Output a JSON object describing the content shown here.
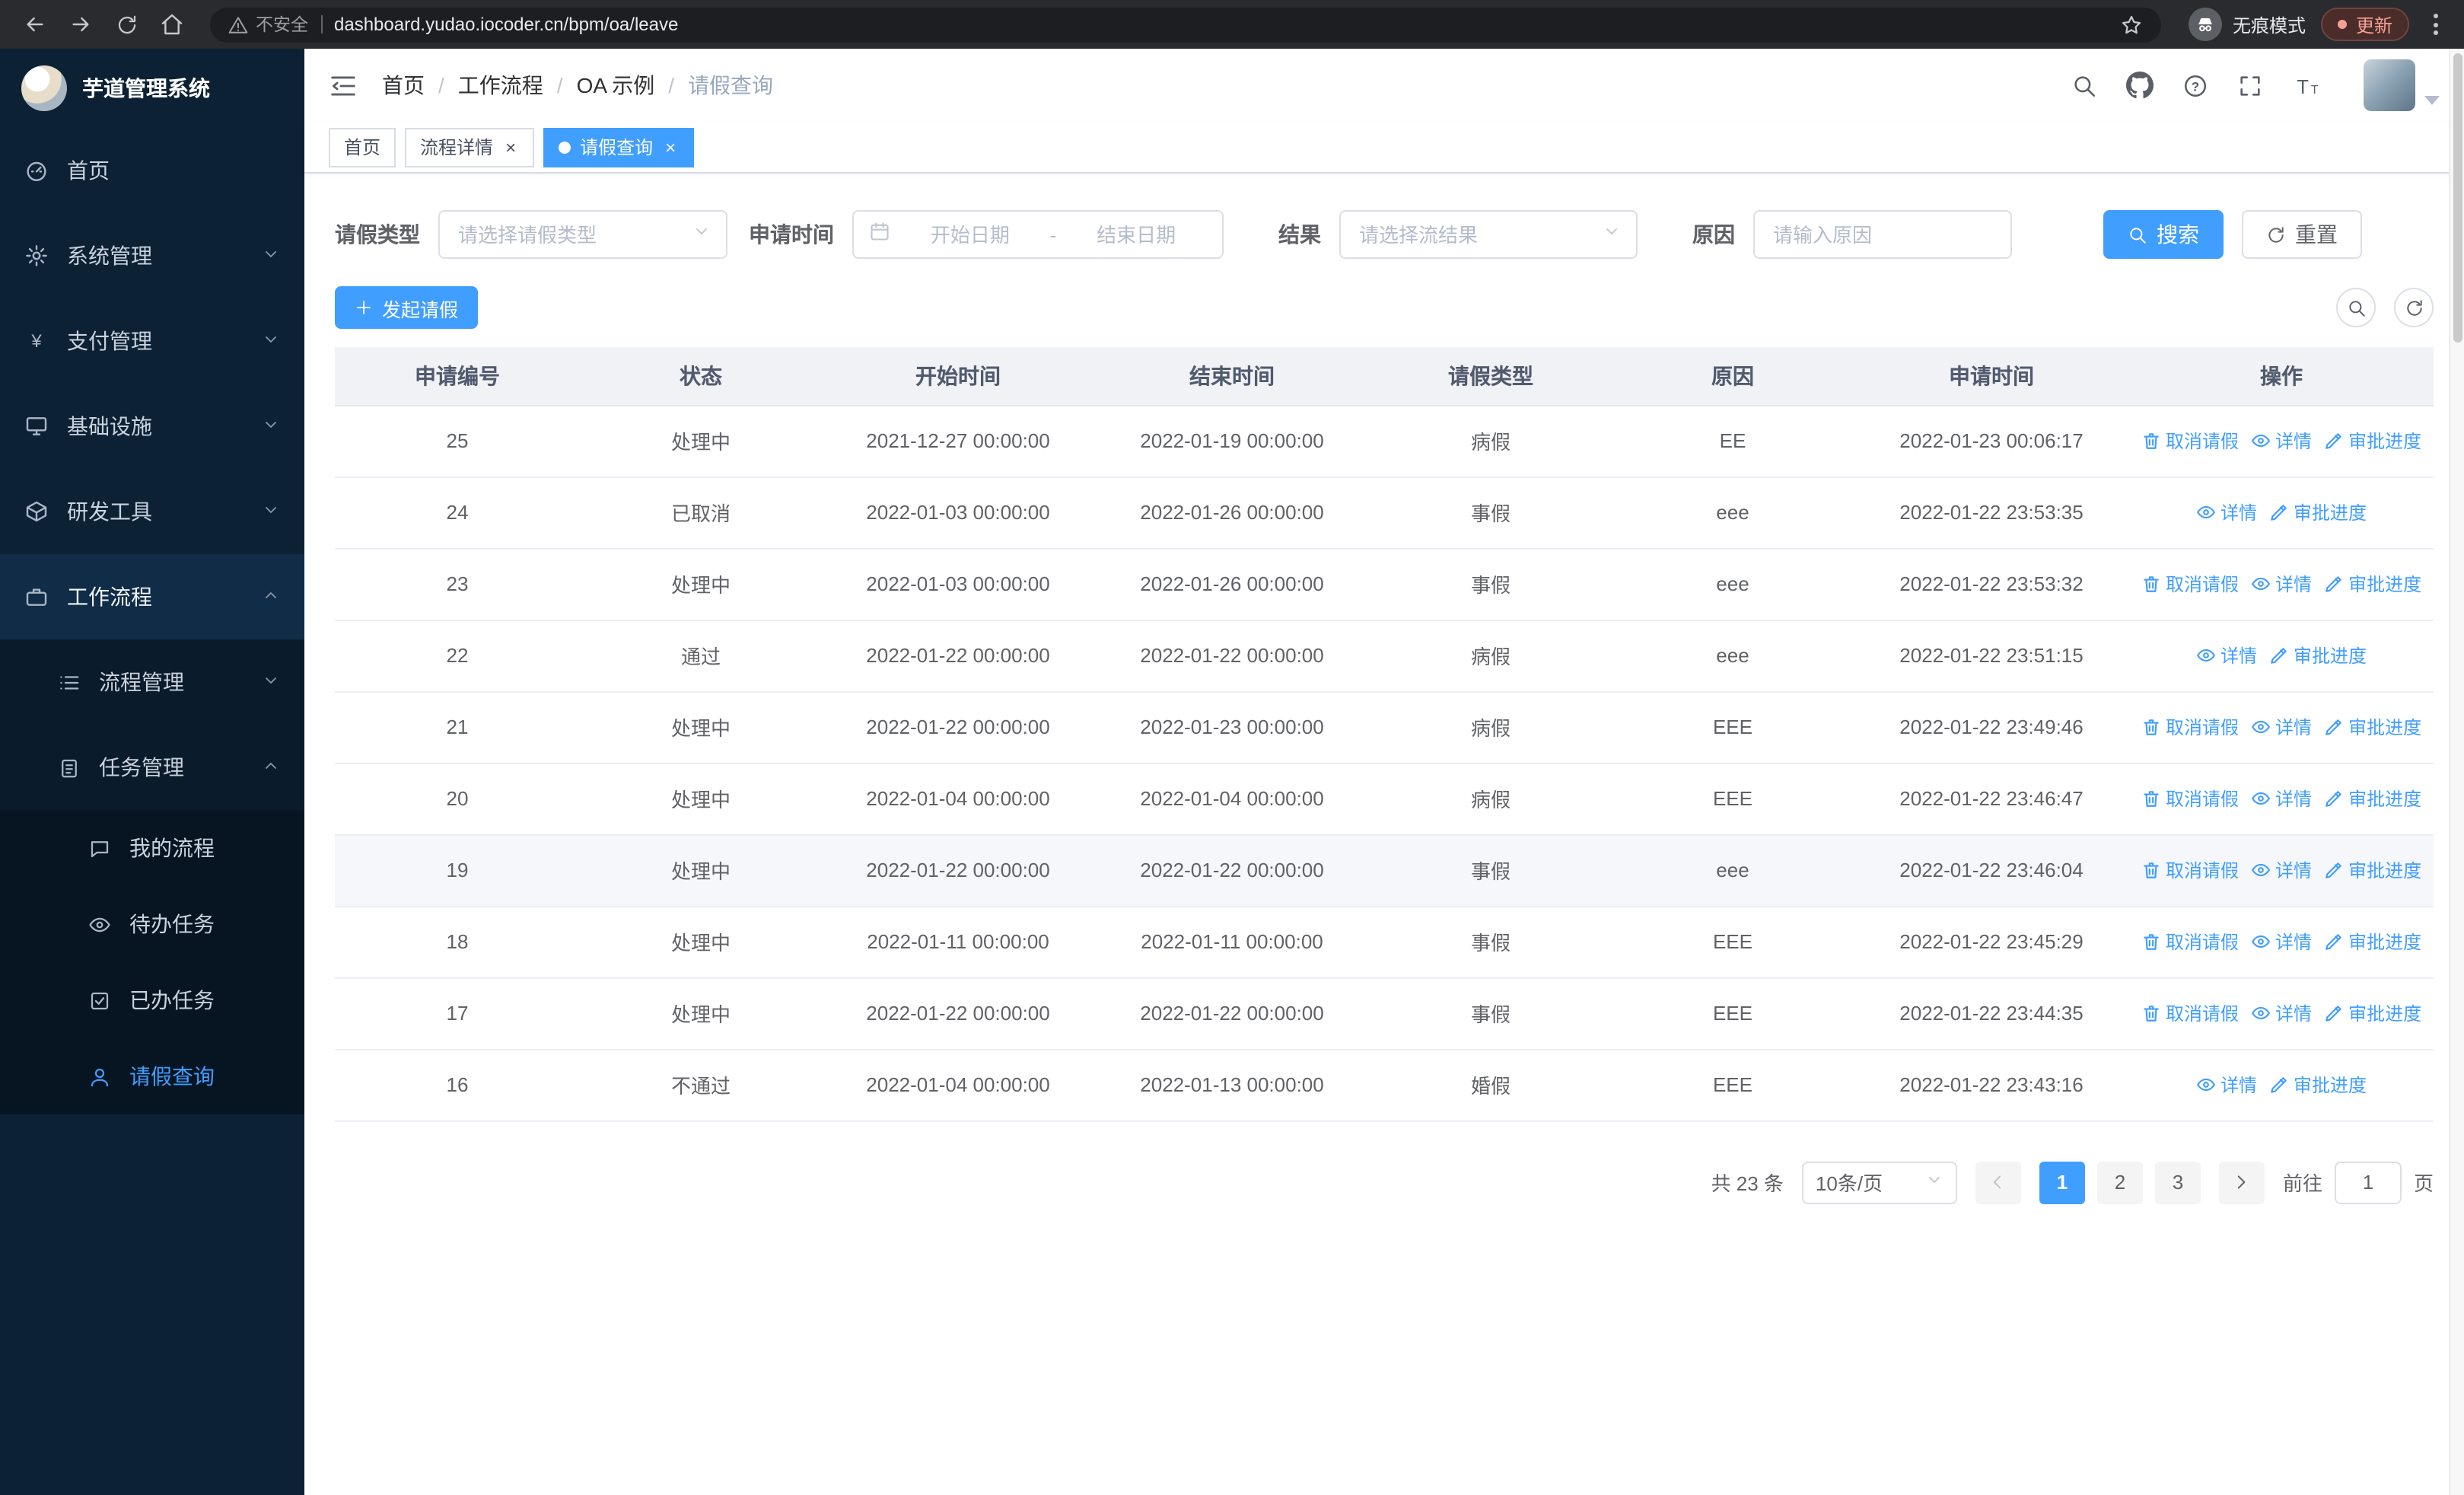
{
  "glyphs": {
    "close": "×"
  },
  "colors": {
    "accent": "#409eff"
  },
  "browser": {
    "security_label": "不安全",
    "url": "dashboard.yudao.iocoder.cn/bpm/oa/leave",
    "incognito_label": "无痕模式",
    "update_label": "更新"
  },
  "sidebar": {
    "app_title": "芋道管理系统",
    "items": [
      {
        "label": "首页"
      },
      {
        "label": "系统管理"
      },
      {
        "label": "支付管理"
      },
      {
        "label": "基础设施"
      },
      {
        "label": "研发工具"
      },
      {
        "label": "工作流程"
      }
    ],
    "submenu": [
      {
        "label": "流程管理"
      },
      {
        "label": "任务管理"
      }
    ],
    "tasks": [
      {
        "label": "我的流程"
      },
      {
        "label": "待办任务"
      },
      {
        "label": "已办任务"
      },
      {
        "label": "请假查询"
      }
    ]
  },
  "header": {
    "breadcrumb": [
      "首页",
      "工作流程",
      "OA 示例",
      "请假查询"
    ]
  },
  "tabs": [
    {
      "label": "首页",
      "closable": false,
      "active": false
    },
    {
      "label": "流程详情",
      "closable": true,
      "active": false
    },
    {
      "label": "请假查询",
      "closable": true,
      "active": true
    }
  ],
  "filters": {
    "leave_type_label": "请假类型",
    "leave_type_placeholder": "请选择请假类型",
    "apply_time_label": "申请时间",
    "start_date_placeholder": "开始日期",
    "range_separator": "-",
    "end_date_placeholder": "结束日期",
    "result_label": "结果",
    "result_placeholder": "请选择流结果",
    "reason_label": "原因",
    "reason_placeholder": "请输入原因",
    "search_button": "搜索",
    "reset_button": "重置"
  },
  "toolbar": {
    "create_button": "发起请假"
  },
  "table": {
    "columns": [
      "申请编号",
      "状态",
      "开始时间",
      "结束时间",
      "请假类型",
      "原因",
      "申请时间",
      "操作"
    ],
    "action_labels": {
      "cancel": "取消请假",
      "detail": "详情",
      "progress": "审批进度"
    },
    "rows": [
      {
        "id": "25",
        "status": "处理中",
        "start": "2021-12-27 00:00:00",
        "end": "2022-01-19 00:00:00",
        "type": "病假",
        "reason": "EE",
        "applied": "2022-01-23 00:06:17",
        "actions": [
          "cancel",
          "detail",
          "progress"
        ],
        "hover": false
      },
      {
        "id": "24",
        "status": "已取消",
        "start": "2022-01-03 00:00:00",
        "end": "2022-01-26 00:00:00",
        "type": "事假",
        "reason": "eee",
        "applied": "2022-01-22 23:53:35",
        "actions": [
          "detail",
          "progress"
        ],
        "hover": false
      },
      {
        "id": "23",
        "status": "处理中",
        "start": "2022-01-03 00:00:00",
        "end": "2022-01-26 00:00:00",
        "type": "事假",
        "reason": "eee",
        "applied": "2022-01-22 23:53:32",
        "actions": [
          "cancel",
          "detail",
          "progress"
        ],
        "hover": false
      },
      {
        "id": "22",
        "status": "通过",
        "start": "2022-01-22 00:00:00",
        "end": "2022-01-22 00:00:00",
        "type": "病假",
        "reason": "eee",
        "applied": "2022-01-22 23:51:15",
        "actions": [
          "detail",
          "progress"
        ],
        "hover": false
      },
      {
        "id": "21",
        "status": "处理中",
        "start": "2022-01-22 00:00:00",
        "end": "2022-01-23 00:00:00",
        "type": "病假",
        "reason": "EEE",
        "applied": "2022-01-22 23:49:46",
        "actions": [
          "cancel",
          "detail",
          "progress"
        ],
        "hover": false
      },
      {
        "id": "20",
        "status": "处理中",
        "start": "2022-01-04 00:00:00",
        "end": "2022-01-04 00:00:00",
        "type": "病假",
        "reason": "EEE",
        "applied": "2022-01-22 23:46:47",
        "actions": [
          "cancel",
          "detail",
          "progress"
        ],
        "hover": false
      },
      {
        "id": "19",
        "status": "处理中",
        "start": "2022-01-22 00:00:00",
        "end": "2022-01-22 00:00:00",
        "type": "事假",
        "reason": "eee",
        "applied": "2022-01-22 23:46:04",
        "actions": [
          "cancel",
          "detail",
          "progress"
        ],
        "hover": true
      },
      {
        "id": "18",
        "status": "处理中",
        "start": "2022-01-11 00:00:00",
        "end": "2022-01-11 00:00:00",
        "type": "事假",
        "reason": "EEE",
        "applied": "2022-01-22 23:45:29",
        "actions": [
          "cancel",
          "detail",
          "progress"
        ],
        "hover": false
      },
      {
        "id": "17",
        "status": "处理中",
        "start": "2022-01-22 00:00:00",
        "end": "2022-01-22 00:00:00",
        "type": "事假",
        "reason": "EEE",
        "applied": "2022-01-22 23:44:35",
        "actions": [
          "cancel",
          "detail",
          "progress"
        ],
        "hover": false
      },
      {
        "id": "16",
        "status": "不通过",
        "start": "2022-01-04 00:00:00",
        "end": "2022-01-13 00:00:00",
        "type": "婚假",
        "reason": "EEE",
        "applied": "2022-01-22 23:43:16",
        "actions": [
          "detail",
          "progress"
        ],
        "hover": false
      }
    ]
  },
  "pagination": {
    "total": "共 23 条",
    "page_size": "10条/页",
    "pages": [
      "1",
      "2",
      "3"
    ],
    "active_page": "1",
    "goto_label": "前往",
    "goto_page": "1",
    "goto_suffix": "页"
  }
}
